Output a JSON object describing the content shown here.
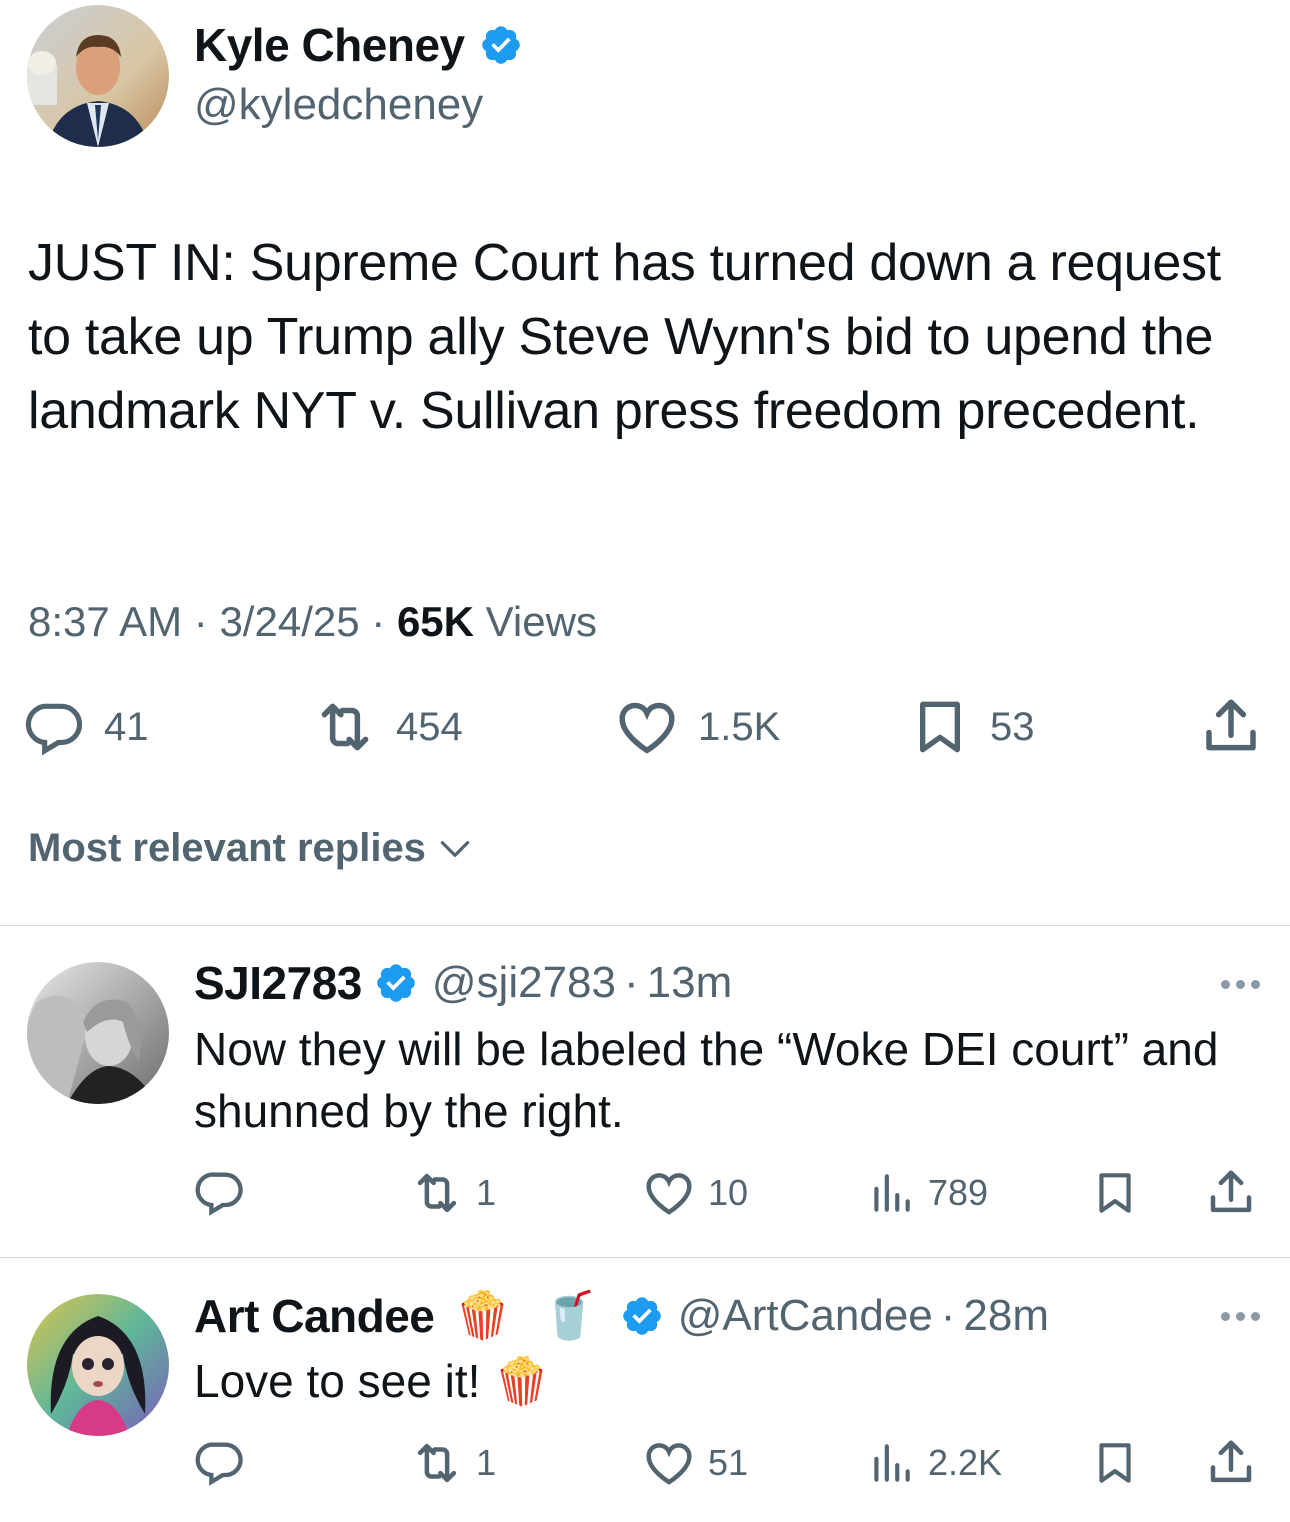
{
  "main_tweet": {
    "author_name": "Kyle Cheney",
    "author_handle": "@kyledcheney",
    "text": "JUST IN: Supreme Court has turned down a request to take up Trump ally Steve Wynn's bid to upend the landmark NYT v. Sullivan press freedom precedent.",
    "time": "8:37 AM",
    "date": "3/24/25",
    "views_count": "65K",
    "views_label": "Views",
    "sep": "·",
    "replies": "41",
    "reposts": "454",
    "likes": "1.5K",
    "bookmarks": "53"
  },
  "replies_sort": {
    "label": "Most relevant replies"
  },
  "replies": [
    {
      "name": "SJI2783",
      "handle": "@sji2783",
      "sep": "·",
      "age": "13m",
      "text": "Now they will be labeled the “Woke DEI court” and shunned by the right.",
      "reposts": "1",
      "likes": "10",
      "views": "789"
    },
    {
      "name": "Art Candee",
      "name_emoji": "🍿 🥤",
      "handle": "@ArtCandee",
      "sep": "·",
      "age": "28m",
      "text": "Love to see it! 🍿",
      "reposts": "1",
      "likes": "51",
      "views": "2.2K"
    }
  ],
  "colors": {
    "verified": "#1d9bf0",
    "muted": "#536471",
    "text": "#0f1419",
    "divider": "#cfd9de"
  },
  "icons": [
    "verified-badge-icon",
    "reply-icon",
    "repost-icon",
    "like-icon",
    "bookmark-icon",
    "share-icon",
    "views-icon",
    "chevron-down-icon",
    "more-icon"
  ]
}
